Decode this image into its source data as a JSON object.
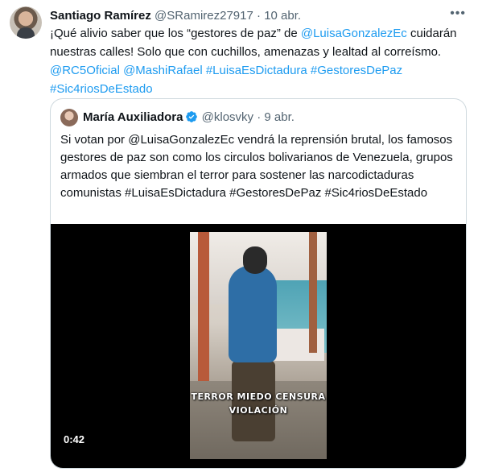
{
  "tweet": {
    "author_name": "Santiago Ramírez",
    "author_handle": "@SRamirez27917",
    "separator": " · ",
    "date": "10 abr.",
    "more_icon": "more-dots-icon",
    "text_part1": "¡Qué alivio saber que los “gestores de paz” de ",
    "mention1": "@LuisaGonzalezEc",
    "text_part2": " cuidarán nuestras calles! Solo que con cuchillos, amenazas y lealtad al correísmo.",
    "mentions_line": "@RC5Oficial @MashiRafael #LuisaEsDictadura #GestoresDePaz",
    "hashtag_last": "#Sic4riosDeEstado"
  },
  "quoted": {
    "author_name": "María Auxiliadora",
    "verified_icon": "verified-badge-icon",
    "author_handle": "@klosvky",
    "separator": " · ",
    "date": "9 abr.",
    "text": "Si votan por @LuisaGonzalezEc vendrá la reprensión brutal, los famosos gestores de paz son como los circulos bolivarianos de Venezuela, grupos armados que siembran el terror para sostener las narcodictaduras comunistas #LuisaEsDictadura #GestoresDePaz #Sic4riosDeEstado",
    "video": {
      "caption_line1": "TERROR MIEDO CENSURA",
      "caption_line2": "VIOLACIÓN",
      "duration": "0:42"
    }
  },
  "colors": {
    "link": "#1d9bf0",
    "text": "#0f1419",
    "muted": "#536471",
    "border": "#cfd9de",
    "verified": "#1d9bf0"
  }
}
